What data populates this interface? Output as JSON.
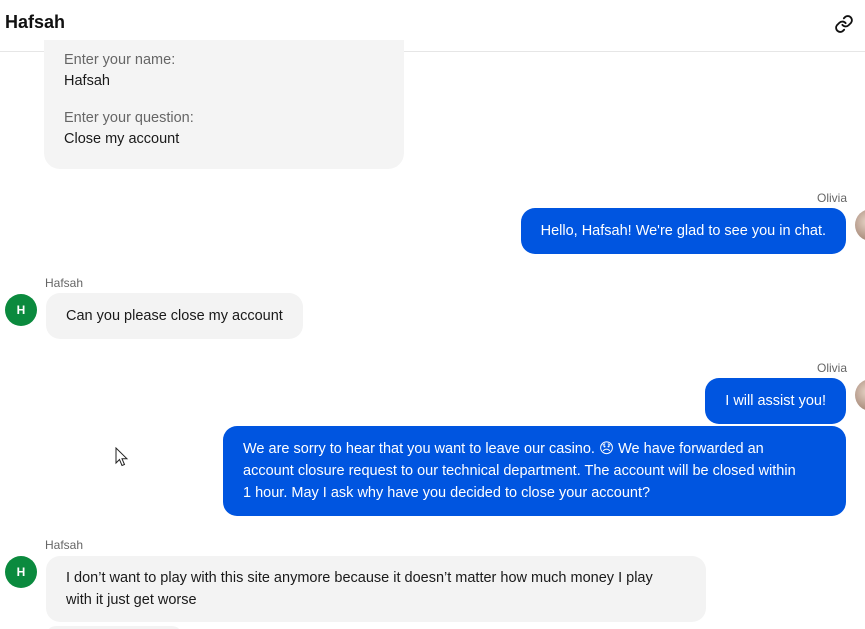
{
  "header": {
    "title": "Hafsah",
    "link_icon": "link-icon"
  },
  "form": {
    "name_label": "Enter your name:",
    "name_value": "Hafsah",
    "question_label": "Enter your question:",
    "question_value": "Close my account"
  },
  "messages": [
    {
      "sender": "Olivia",
      "text": "Hello, Hafsah! We're glad to see you in chat."
    },
    {
      "sender": "Hafsah",
      "avatar": "H",
      "text": "Can you please close my account"
    },
    {
      "sender": "Olivia",
      "text": "I will assist you!"
    },
    {
      "lines": [
        "We are sorry to hear that you want to leave our casino. 😞 We have forwarded an",
        "account closure request to our technical department. The account will be closed within",
        "1 hour. May I ask why have you decided to close your account?"
      ]
    },
    {
      "sender": "Hafsah",
      "avatar": "H",
      "lines": [
        "I don’t want to play with this site anymore because it doesn’t matter how much money I play",
        "with it just get worse"
      ]
    }
  ],
  "colors": {
    "operator_bubble": "#0055e0",
    "user_bubble": "#f3f3f3",
    "user_avatar": "#0b8a3e"
  }
}
